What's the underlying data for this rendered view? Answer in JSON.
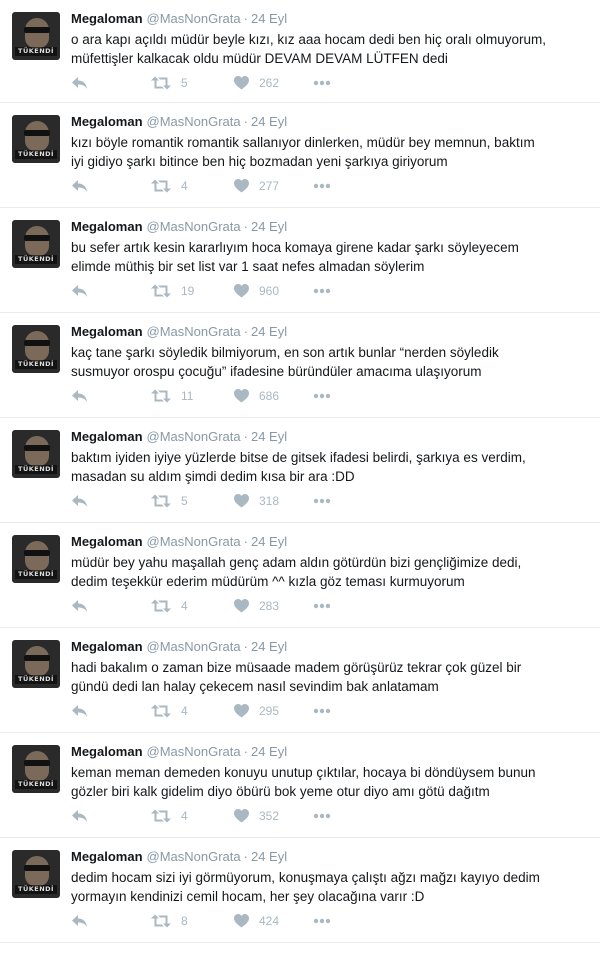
{
  "author": {
    "name": "Megaloman",
    "handle": "@MasNonGrata",
    "avatar_tag": "TÜKENDİ"
  },
  "separator": "·",
  "tweets": [
    {
      "time": "24 Eyl",
      "text": "o ara kapı açıldı müdür beyle kızı, kız aaa hocam dedi ben hiç oralı olmuyorum,\nmüfettişler kalkacak oldu müdür DEVAM DEVAM LÜTFEN dedi",
      "retweets": "5",
      "likes": "262"
    },
    {
      "time": "24 Eyl",
      "text": "kızı böyle romantik romantik sallanıyor dinlerken, müdür bey memnun, baktım\niyi gidiyo şarkı bitince ben hiç bozmadan yeni şarkıya giriyorum",
      "retweets": "4",
      "likes": "277"
    },
    {
      "time": "24 Eyl",
      "text": "bu sefer artık kesin kararlıyım hoca komaya girene kadar şarkı söyleyecem\nelimde müthiş bir set list var 1 saat nefes almadan söylerim",
      "retweets": "19",
      "likes": "960"
    },
    {
      "time": "24 Eyl",
      "text": "kaç tane şarkı söyledik bilmiyorum, en son artık bunlar “nerden söyledik\nsusmuyor orospu çocuğu” ifadesine büründüler amacıma ulaşıyorum",
      "retweets": "11",
      "likes": "686"
    },
    {
      "time": "24 Eyl",
      "text": "baktım iyiden iyiye yüzlerde bitse de gitsek ifadesi belirdi, şarkıya es verdim,\nmasadan su aldım şimdi dedim kısa bir ara :DD",
      "retweets": "5",
      "likes": "318"
    },
    {
      "time": "24 Eyl",
      "text": "müdür bey yahu maşallah genç adam aldın götürdün bizi gençliğimize dedi,\ndedim teşekkür ederim müdürüm ^^ kızla göz teması kurmuyorum",
      "retweets": "4",
      "likes": "283"
    },
    {
      "time": "24 Eyl",
      "text": "hadi bakalım o zaman bize müsaade madem görüşürüz tekrar çok güzel bir\ngündü dedi lan halay çekecem nasıl sevindim bak anlatamam",
      "retweets": "4",
      "likes": "295"
    },
    {
      "time": "24 Eyl",
      "text": "keman meman demeden konuyu unutup çıktılar, hocaya bi döndüysem bunun\ngözler biri kalk gidelim diyo öbürü bok yeme otur diyo amı götü dağıtm",
      "retweets": "4",
      "likes": "352"
    },
    {
      "time": "24 Eyl",
      "text": "dedim hocam sizi iyi görmüyorum, konuşmaya çalıştı ağzı mağzı kayıyo dedim\nyormayın kendinizi cemil hocam, her şey olacağına varır :D",
      "retweets": "8",
      "likes": "424"
    }
  ],
  "icons": {
    "reply": "reply-icon",
    "retweet": "retweet-icon",
    "like": "heart-icon",
    "more": "more-icon"
  },
  "colors": {
    "text": "#14171a",
    "muted": "#8899a6",
    "icon": "#aab8c2",
    "divider": "#e6ecf0"
  }
}
